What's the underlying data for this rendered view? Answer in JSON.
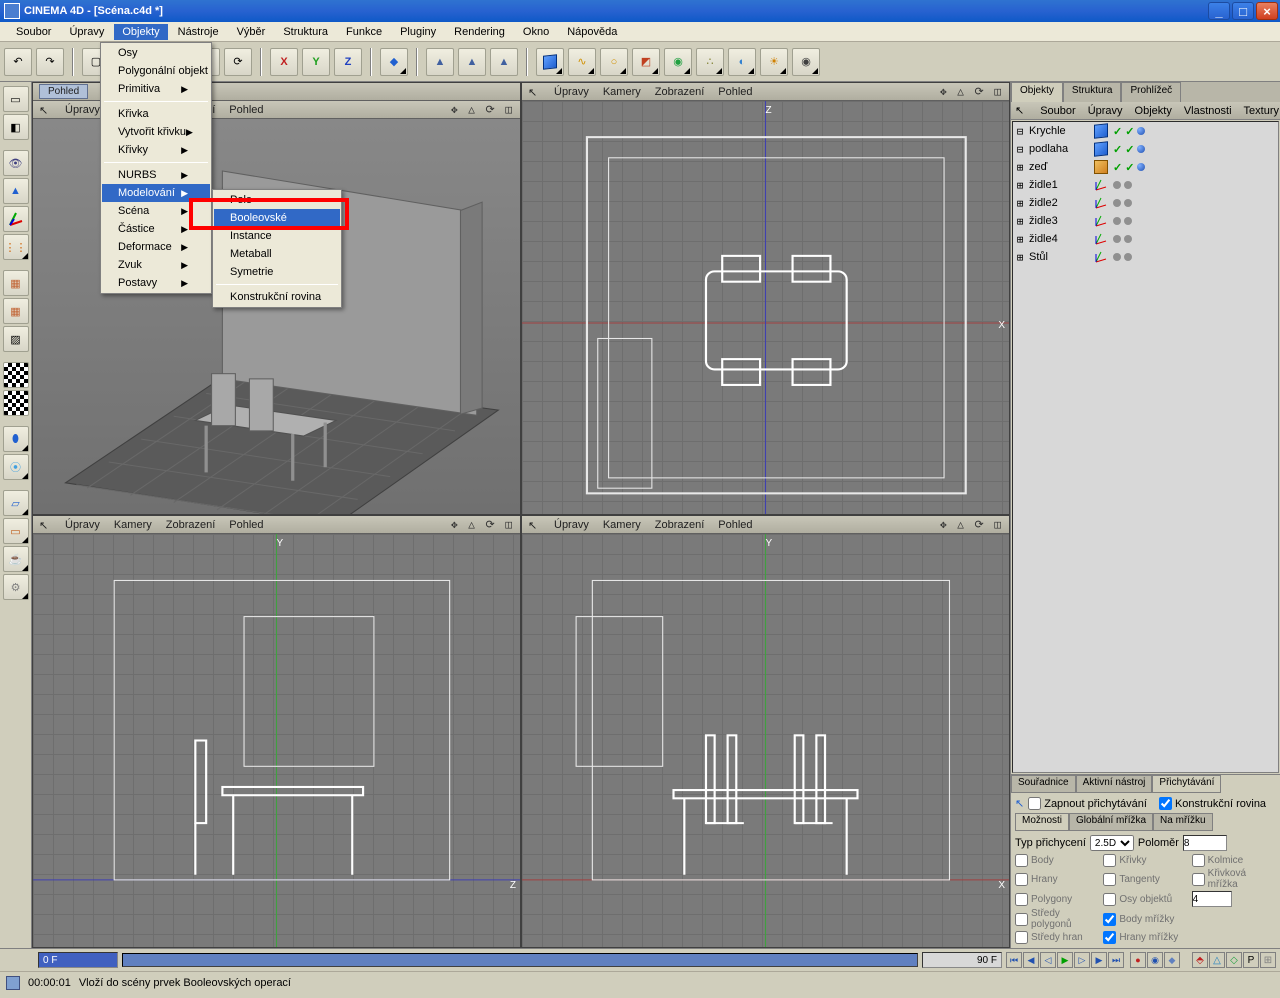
{
  "title": "CINEMA 4D - [Scéna.c4d *]",
  "menubar": [
    "Soubor",
    "Úpravy",
    "Objekty",
    "Nástroje",
    "Výběr",
    "Struktura",
    "Funkce",
    "Pluginy",
    "Rendering",
    "Okno",
    "Nápověda"
  ],
  "menubar_active": "Objekty",
  "dropdown1": {
    "groups": [
      [
        "Osy",
        "Polygonální objekt",
        "Primitiva ▸"
      ],
      [
        "Křivka",
        "Vytvořit křivku ▸",
        "Křivky ▸"
      ],
      [
        "NURBS ▸",
        "Modelování ▸",
        "Scéna ▸",
        "Částice ▸",
        "Deformace ▸",
        "Zvuk ▸",
        "Postavy ▸"
      ]
    ],
    "hover": "Modelování ▸"
  },
  "dropdown2": {
    "items": [
      "Pole",
      "Booleovské",
      "Instance",
      "Metaball",
      "Symetrie"
    ],
    "sep_after": 4,
    "extra": [
      "Konstrukční rovina"
    ],
    "hover": "Booleovské"
  },
  "vp_header_menus": [
    "Úpravy",
    "Kamery",
    "Zobrazení",
    "Pohled"
  ],
  "vp_header_ctrls": "✥ △ ⟳ ◫",
  "vp_tab_label": "Pohled",
  "right_tabs": [
    "Objekty",
    "Struktura",
    "Prohlížeč"
  ],
  "right_menubar": [
    "Soubor",
    "Úpravy",
    "Objekty",
    "Vlastnosti",
    "Textury"
  ],
  "objects": [
    {
      "exp": "",
      "name": "Krychle",
      "icon": "cube",
      "tags": [
        "green",
        "green",
        "sphere"
      ]
    },
    {
      "exp": "",
      "name": "podlaha",
      "icon": "cube",
      "tags": [
        "green",
        "green",
        "sphere"
      ]
    },
    {
      "exp": "+",
      "name": "zeď",
      "icon": "ocube",
      "tags": [
        "green",
        "green",
        "sphere"
      ]
    },
    {
      "exp": "+",
      "name": "židle1",
      "icon": "axis",
      "tags": [
        "gray",
        "gray"
      ]
    },
    {
      "exp": "+",
      "name": "židle2",
      "icon": "axis",
      "tags": [
        "gray",
        "gray"
      ]
    },
    {
      "exp": "+",
      "name": "židle3",
      "icon": "axis",
      "tags": [
        "gray",
        "gray"
      ]
    },
    {
      "exp": "+",
      "name": "židle4",
      "icon": "axis",
      "tags": [
        "gray",
        "gray"
      ]
    },
    {
      "exp": "+",
      "name": "Stůl",
      "icon": "axis",
      "tags": [
        "gray",
        "gray"
      ]
    }
  ],
  "bottom_tabs": [
    "Souřadnice",
    "Aktivní nástroj",
    "Přichytávání"
  ],
  "snap": {
    "enable_label": "Zapnout přichytávání",
    "plane_label": "Konstrukční rovina",
    "tabs": [
      "Možnosti",
      "Globální mřížka",
      "Na mřížku"
    ],
    "type_label": "Typ přichycení",
    "type_value": "2.5D",
    "radius_label": "Poloměr",
    "radius_value": "8",
    "checks": [
      [
        "Body",
        "Křivky",
        "Kolmice"
      ],
      [
        "Hrany",
        "Tangenty",
        "Křivková mřížka"
      ],
      [
        "Polygony",
        "Osy objektů",
        "4"
      ],
      [
        "Středy polygonů",
        "Body mřížky",
        ""
      ],
      [
        "Středy hran",
        "Hrany mřížky",
        ""
      ]
    ]
  },
  "timeline": {
    "cur": "0 F",
    "end": "90 F"
  },
  "status": {
    "time": "00:00:01",
    "msg": "Vloží do scény prvek Booleovských operací"
  }
}
